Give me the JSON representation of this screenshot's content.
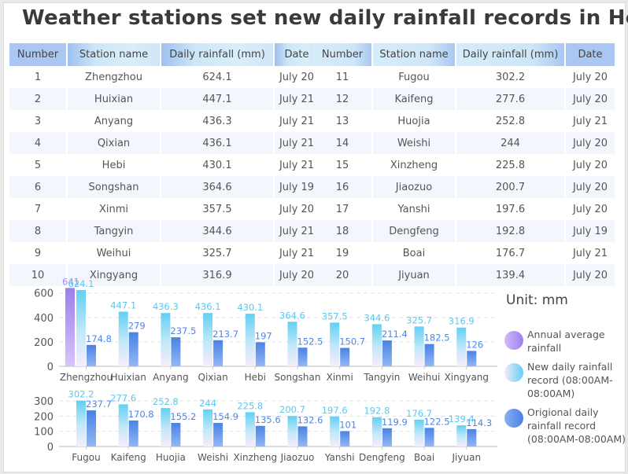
{
  "title": "Weather stations set new daily rainfall records in Henan",
  "table": {
    "headers": [
      "Number",
      "Station name",
      "Daily rainfall (mm)",
      "Date"
    ],
    "rows": [
      {
        "number": "1",
        "station": "Zhengzhou",
        "rainfall": "624.1",
        "date": "July 20"
      },
      {
        "number": "2",
        "station": "Huixian",
        "rainfall": "447.1",
        "date": "July 21"
      },
      {
        "number": "3",
        "station": "Anyang",
        "rainfall": "436.3",
        "date": "July 21"
      },
      {
        "number": "4",
        "station": "Qixian",
        "rainfall": "436.1",
        "date": "July 21"
      },
      {
        "number": "5",
        "station": "Hebi",
        "rainfall": "430.1",
        "date": "July 21"
      },
      {
        "number": "6",
        "station": "Songshan",
        "rainfall": "364.6",
        "date": "July 19"
      },
      {
        "number": "7",
        "station": "Xinmi",
        "rainfall": "357.5",
        "date": "July 20"
      },
      {
        "number": "8",
        "station": "Tangyin",
        "rainfall": "344.6",
        "date": "July 21"
      },
      {
        "number": "9",
        "station": "Weihui",
        "rainfall": "325.7",
        "date": "July 21"
      },
      {
        "number": "10",
        "station": "Xingyang",
        "rainfall": "316.9",
        "date": "July 20"
      },
      {
        "number": "11",
        "station": "Fugou",
        "rainfall": "302.2",
        "date": "July 20"
      },
      {
        "number": "12",
        "station": "Kaifeng",
        "rainfall": "277.6",
        "date": "July 20"
      },
      {
        "number": "13",
        "station": "Huojia",
        "rainfall": "252.8",
        "date": "July 21"
      },
      {
        "number": "14",
        "station": "Weishi",
        "rainfall": "244",
        "date": "July 20"
      },
      {
        "number": "15",
        "station": "Xinzheng",
        "rainfall": "225.8",
        "date": "July 20"
      },
      {
        "number": "16",
        "station": "Jiaozuo",
        "rainfall": "200.7",
        "date": "July 20"
      },
      {
        "number": "17",
        "station": "Yanshi",
        "rainfall": "197.6",
        "date": "July 20"
      },
      {
        "number": "18",
        "station": "Dengfeng",
        "rainfall": "192.8",
        "date": "July 19"
      },
      {
        "number": "19",
        "station": "Boai",
        "rainfall": "176.7",
        "date": "July 21"
      },
      {
        "number": "20",
        "station": "Jiyuan",
        "rainfall": "139.4",
        "date": "July 20"
      }
    ]
  },
  "unit_label": "Unit: mm",
  "legend": [
    {
      "label": "Annual average rainfall",
      "color": "#a98bf0"
    },
    {
      "label": "New daily rainfall record (08:00AM-08:00AM)",
      "color": "#67d2f2"
    },
    {
      "label": "Origional daily rainfall record (08:00AM-08:00AM)",
      "color": "#4f86e8"
    }
  ],
  "chart_data": [
    {
      "type": "bar",
      "title": "",
      "xlabel": "",
      "ylabel": "",
      "ylim": [
        0,
        641
      ],
      "yticks": [
        0,
        200,
        400,
        600
      ],
      "grid": true,
      "categories": [
        "Zhengzhou",
        "Huixian",
        "Anyang",
        "Qixian",
        "Hebi",
        "Songshan",
        "Xinmi",
        "Tangyin",
        "Weihui",
        "Xingyang"
      ],
      "series": [
        {
          "name": "Annual average rainfall",
          "values": [
            641,
            null,
            null,
            null,
            null,
            null,
            null,
            null,
            null,
            null
          ],
          "color": "#a98bf0"
        },
        {
          "name": "New daily rainfall record (08:00AM-08:00AM)",
          "values": [
            624.1,
            447.1,
            436.3,
            436.1,
            430.1,
            364.6,
            357.5,
            344.6,
            325.7,
            316.9
          ],
          "color": "#67d2f2"
        },
        {
          "name": "Origional daily rainfall record (08:00AM-08:00AM)",
          "values": [
            174.8,
            279,
            237.5,
            213.7,
            197,
            152.5,
            150.7,
            211.4,
            182.5,
            126
          ],
          "color": "#4f86e8"
        }
      ],
      "legend_position": "right"
    },
    {
      "type": "bar",
      "title": "",
      "xlabel": "",
      "ylabel": "",
      "ylim": [
        0,
        310
      ],
      "yticks": [
        0,
        100,
        200,
        300
      ],
      "grid": true,
      "categories": [
        "Fugou",
        "Kaifeng",
        "Huojia",
        "Weishi",
        "Xinzheng",
        "Jiaozuo",
        "Yanshi",
        "Dengfeng",
        "Boai",
        "Jiyuan"
      ],
      "series": [
        {
          "name": "New daily rainfall record (08:00AM-08:00AM)",
          "values": [
            302.2,
            277.6,
            252.8,
            244,
            225.8,
            200.7,
            197.6,
            192.8,
            176.7,
            139.4
          ],
          "color": "#67d2f2"
        },
        {
          "name": "Origional daily rainfall record (08:00AM-08:00AM)",
          "values": [
            237.7,
            170.8,
            155.2,
            154.9,
            135.6,
            132.6,
            101,
            119.9,
            122.5,
            114.3
          ],
          "color": "#4f86e8"
        }
      ],
      "legend_position": "right"
    }
  ]
}
